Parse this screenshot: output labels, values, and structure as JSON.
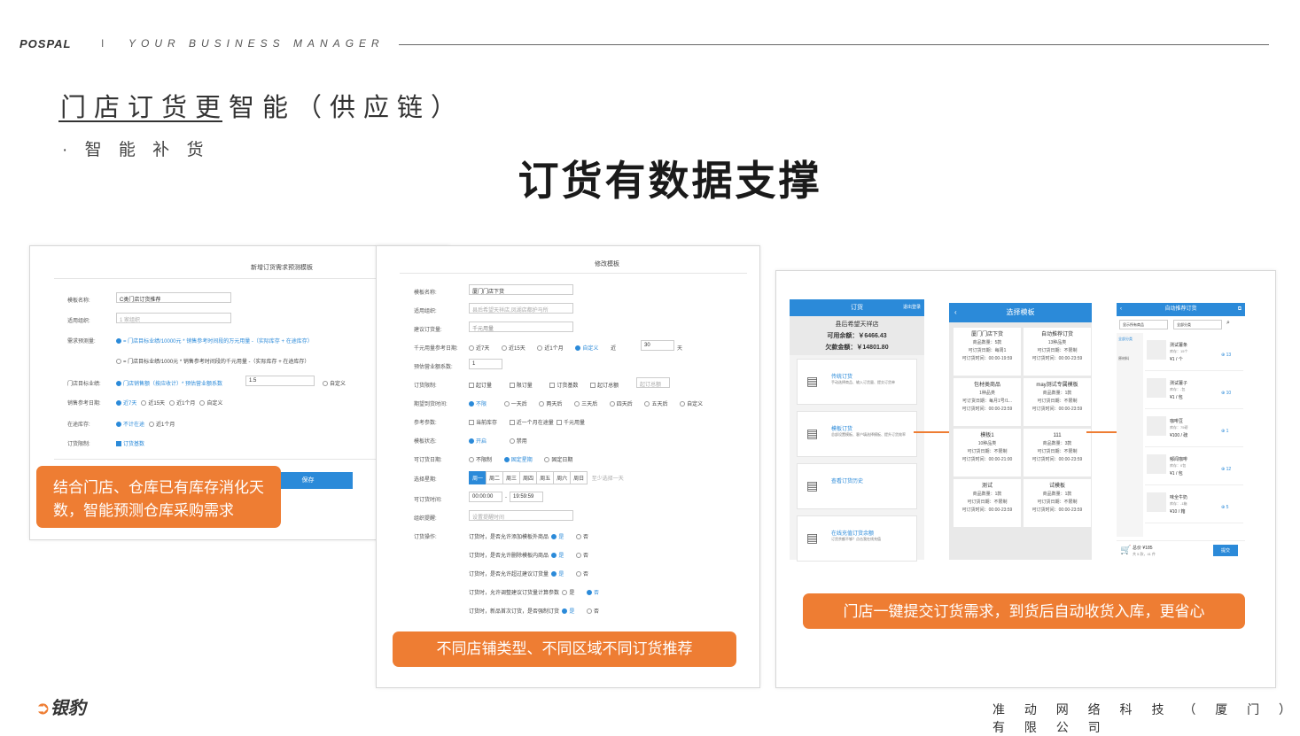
{
  "header": {
    "brand": "POSPAL",
    "separator": "I",
    "tagline": "YOUR BUSINESS MANAGER"
  },
  "title": "门店订货更智能（供应链）",
  "subtitle": "· 智 能 补 货",
  "center_title": "订货有数据支撑",
  "panel1": {
    "title": "新增订货需求预测模板",
    "fields": {
      "template_name_label": "模板名称:",
      "template_name_value": "C类门店订货推荐",
      "org_label": "适用组织:",
      "org_value": "1 家组织",
      "method_label": "需求预测量:",
      "method1": "= 门店目标业绩/10000元 * 销售参考时间段的万元用量 -（实际库存 + 在途库存）",
      "method2": "= 门店目标业绩/1000元 * 销售参考时间段的千元用量 -（实际库存 + 在途库存）",
      "target_label": "门店目标业绩:",
      "target_opt": "门店销售额（按应收计）* 预估营业额系数",
      "target_value": "1.5",
      "custom": "自定义",
      "ref_label": "销售参考日期:",
      "ref_opts": [
        "近7天",
        "近15天",
        "近1个月",
        "自定义"
      ],
      "transit_label": "在途库存:",
      "transit_opts": [
        "不计在途",
        "近1个月"
      ],
      "limit_label": "订货限制:",
      "limit_opt": "订货基数",
      "save": "保存"
    }
  },
  "panel2": {
    "title": "修改模板",
    "name_label": "模板名称:",
    "name_value": "厦门门店下货",
    "org_label": "适用组织:",
    "org_placeholder": "县后希望天祥店,凤湖店都护马所",
    "suggest_label": "建议订货量:",
    "suggest_value": "千元用量",
    "date_label": "千元用量参考日期:",
    "date_opts": [
      "近7天",
      "近15天",
      "近1个月",
      "自定义"
    ],
    "date_near": "近",
    "date_days": "30",
    "date_unit": "天",
    "coef_label": "预估营业额系数:",
    "coef_value": "1",
    "limit_label": "订货限制:",
    "limit_opts": [
      "起订量",
      "限订量",
      "订货基数",
      "起订总额"
    ],
    "limit_placeholder": "起订总额",
    "arrive_label": "期望到货时间:",
    "arrive_opts": [
      "不限",
      "一天后",
      "两天后",
      "三天后",
      "四天后",
      "五天后",
      "自定义"
    ],
    "ref_label": "参考参数:",
    "ref_opts": [
      "当前库存",
      "近一个月在途量",
      "千元用量"
    ],
    "status_label": "模板状态:",
    "status_opts": [
      "开启",
      "禁用"
    ],
    "day_label": "可订货日期:",
    "day_opts": [
      "不限制",
      "固定星期",
      "固定日期"
    ],
    "week_label": "选择星期:",
    "weeks": [
      "周一",
      "周二",
      "周三",
      "周四",
      "周五",
      "周六",
      "周日"
    ],
    "week_hint": "至少选择一天",
    "time_label": "可订货时间:",
    "time_from": "00:00:00",
    "time_to": "19:59:59",
    "remind_label": "组织提醒:",
    "remind_placeholder": "设置提醒时间",
    "ops_label": "订货操作:",
    "ops": [
      {
        "text": "订货时，是否允许添加模板外商品",
        "yes": "是",
        "no": "否"
      },
      {
        "text": "订货时，是否允许删除模板内商品",
        "yes": "是",
        "no": "否"
      },
      {
        "text": "订货时，是否允许超过建议订货量",
        "yes": "是",
        "no": "否"
      },
      {
        "text": "订货时，允许调整建议订货量计算参数",
        "yes": "是",
        "no": "否"
      },
      {
        "text": "订货时，新品首次订货，是否强制订货",
        "yes": "是",
        "no": "否"
      }
    ]
  },
  "panel3": {
    "phone1": {
      "header": "订货",
      "logout": "退出登录",
      "store": "县后希望天祥店",
      "balance": "可用余额：￥6466.43",
      "debt": "欠款金额：￥14801.80",
      "items": [
        {
          "title": "传统订货",
          "desc": "手动选择商品、输入订货量、提交订货单"
        },
        {
          "title": "模板订货",
          "desc": "总部设置模板、客户填选择模板、提升订货效率"
        },
        {
          "title": "查看订货历史",
          "desc": ""
        },
        {
          "title": "在线充值订货余额",
          "desc": "订货余额不够？点击我在线充值"
        }
      ]
    },
    "phone2": {
      "header": "选择模板",
      "cells": [
        {
          "t": "厦门门店下货",
          "a": "商品数量：5款",
          "b": "可订货日期：每周1",
          "c": "可订货时间：00:00-19:59"
        },
        {
          "t": "自动推荐订货",
          "a": "13种品类",
          "b": "可订货日期：不限制",
          "c": "可订货时间：00:00-23:59"
        },
        {
          "t": "包材类商品",
          "a": "1种品类",
          "b": "可订货日期：每月1号/1...",
          "c": "可订货时间：00:00-23:59"
        },
        {
          "t": "may测试专属模板",
          "a": "商品数量：1款",
          "b": "可订货日期：不限制",
          "c": "可订货时间：00:00-23:59"
        },
        {
          "t": "模板1",
          "a": "10种品类",
          "b": "可订货日期：不限制",
          "c": "可订货时间：00:00-21:00"
        },
        {
          "t": "111",
          "a": "商品数量：3款",
          "b": "可订货日期：不限制",
          "c": "可订货时间：00:00-23:59"
        },
        {
          "t": "测试",
          "a": "商品数量：1款",
          "b": "可订货日期：不限制",
          "c": "可订货时间：00:00-23:59"
        },
        {
          "t": "试模板",
          "a": "商品数量：1款",
          "b": "可订货日期：不限制",
          "c": "可订货时间：00:00-23:59"
        }
      ]
    },
    "phone3": {
      "header": "自动推荐订货",
      "filter1": "显示所有商品",
      "filter2": "全部分类",
      "cats": [
        "全部分类",
        "原材料"
      ],
      "products": [
        {
          "name": "测试薯条",
          "stock": "库存：15个",
          "price": "¥1 / 个",
          "qty": "13"
        },
        {
          "name": "测试薯子",
          "stock": "库存：-包",
          "price": "¥1 / 包",
          "qty": "10"
        },
        {
          "name": "咖啡豆",
          "stock": "库存：75磅",
          "price": "¥100 / 磅",
          "qty": "1"
        },
        {
          "name": "郁闻咖啡",
          "stock": "库存：0包",
          "price": "¥1 / 包",
          "qty": "12"
        },
        {
          "name": "味全牛奶",
          "stock": "库存：-1箱",
          "price": "¥10 / 箱",
          "qty": "5"
        }
      ],
      "total": "总价 ¥185",
      "total_sub": "共 5 款，41 件",
      "submit": "提交"
    }
  },
  "callouts": {
    "c1": "结合门店、仓库已有库存消化天数，智能预测仓库采购需求",
    "c2": "不同店铺类型、不同区域不同订货推荐",
    "c3": "门店一键提交订货需求，到货后自动收货入库，更省心"
  },
  "footer": {
    "logo": "银豹",
    "company": "准 动 网 络 科 技 （ 厦 门 ） 有 限 公 司"
  },
  "colors": {
    "accent_blue": "#2b8ad9",
    "accent_orange": "#ee7d33"
  }
}
